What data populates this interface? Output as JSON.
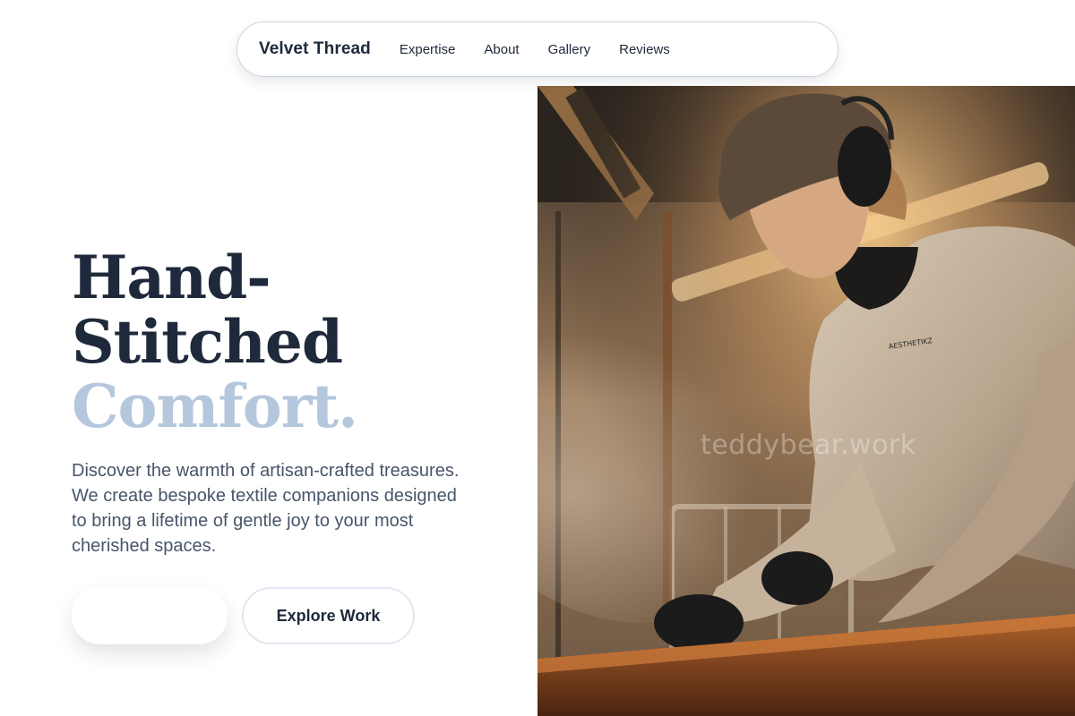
{
  "nav": {
    "brand": "Velvet Thread",
    "links": [
      "Expertise",
      "About",
      "Gallery",
      "Reviews"
    ]
  },
  "hero": {
    "headline_line1": "Hand-",
    "headline_line2": "Stitched",
    "headline_accent": "Comfort.",
    "description": "Discover the warmth of artisan-crafted treasures. We create bespoke textile companions designed to bring a lifetime of gentle joy to your most cherished spaces.",
    "primary_button_label": "",
    "secondary_button_label": "Explore Work"
  },
  "image": {
    "watermark": "teddybear.work",
    "sweatshirt_print": "AESTHETIKZ"
  },
  "colors": {
    "text_dark": "#1e293b",
    "accent_blue": "#b4c7dd",
    "body_text": "#475569"
  }
}
